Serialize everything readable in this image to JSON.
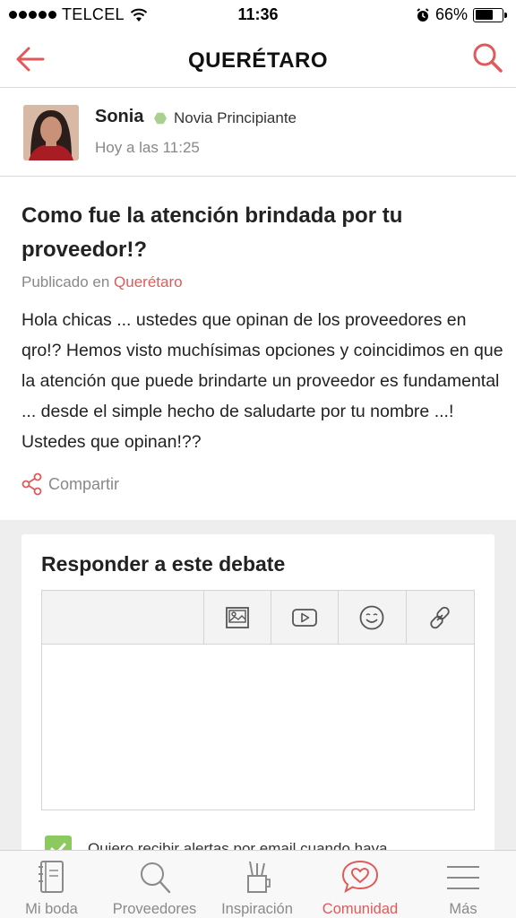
{
  "status_bar": {
    "carrier": "TELCEL",
    "time": "11:36",
    "battery": "66%",
    "battery_level": 0.66
  },
  "nav": {
    "title": "QUERÉTARO",
    "back_icon": "arrow-left-icon",
    "search_icon": "search-icon"
  },
  "author": {
    "name": "Sonia",
    "rank": "Novia Principiante",
    "time": "Hoy a las 11:25"
  },
  "post": {
    "title": "Como fue la atención brindada por tu proveedor!?",
    "published_prefix": "Publicado en",
    "published_location": "Querétaro",
    "body": "Hola chicas ... ustedes que opinan de los proveedores en qro!? Hemos visto muchísimas opciones y coincidimos en que la atención que puede brindarte un proveedor es fundamental ... desde el simple hecho de saludarte por tu nombre ...! Ustedes que opinan!??",
    "share_label": "Compartir"
  },
  "reply": {
    "title": "Responder a este debate",
    "toolbar": [
      "image-icon",
      "video-icon",
      "emoji-icon",
      "link-icon"
    ],
    "alert_label": "Quiero recibir alertas por email cuando haya",
    "alert_checked": true
  },
  "tabs": [
    {
      "label": "Mi boda",
      "icon": "notebook-icon",
      "active": false
    },
    {
      "label": "Proveedores",
      "icon": "search-icon",
      "active": false
    },
    {
      "label": "Inspiración",
      "icon": "pencil-cup-icon",
      "active": false
    },
    {
      "label": "Comunidad",
      "icon": "heart-chat-icon",
      "active": true
    },
    {
      "label": "Más",
      "icon": "menu-icon",
      "active": false
    }
  ],
  "colors": {
    "accent": "#e05a5a",
    "rank_badge": "#a9d08e",
    "checkbox": "#8cc95e"
  }
}
